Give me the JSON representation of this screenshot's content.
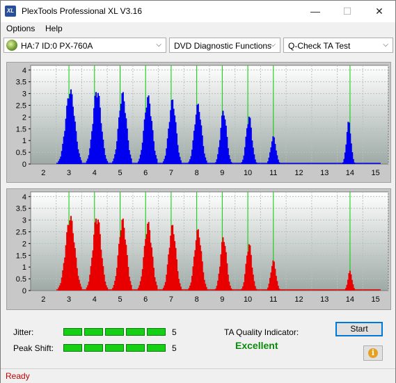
{
  "window": {
    "title": "PlexTools Professional XL V3.16",
    "icon_text": "XL",
    "minimize": "—",
    "maximize": "☐",
    "close": "✕"
  },
  "menu": {
    "items": [
      "Options",
      "Help"
    ]
  },
  "toolbar": {
    "drive": "HA:7 ID:0  PX-760A",
    "function": "DVD Diagnostic Functions",
    "test": "Q-Check TA Test"
  },
  "charts": {
    "x_ticks": [
      "2",
      "3",
      "4",
      "5",
      "6",
      "7",
      "8",
      "9",
      "10",
      "11",
      "12",
      "13",
      "14",
      "15"
    ],
    "y_ticks": [
      "4",
      "3.5",
      "3",
      "2.5",
      "2",
      "1.5",
      "1",
      "0.5",
      "0"
    ],
    "colors": {
      "top": "#0000ee",
      "bottom": "#e80000",
      "green_line": "#00cc00",
      "plot_bg_top": "#ffffff",
      "plot_bg_bottom": "#9eaaa6"
    }
  },
  "chart_data": [
    {
      "type": "bar",
      "series": [
        {
          "values": "see peaks"
        }
      ],
      "xlim": [
        1.5,
        15.5
      ],
      "ylim": [
        0,
        4.2
      ],
      "green_lines": [
        3,
        4,
        5,
        6,
        7,
        8,
        9,
        10,
        11,
        14
      ],
      "peaks": [
        {
          "center": 3.05,
          "height": 3.25,
          "width": 0.45
        },
        {
          "center": 4.1,
          "height": 3.3,
          "width": 0.4
        },
        {
          "center": 5.1,
          "height": 3.1,
          "width": 0.38
        },
        {
          "center": 6.1,
          "height": 2.95,
          "width": 0.38
        },
        {
          "center": 7.05,
          "height": 2.8,
          "width": 0.35
        },
        {
          "center": 8.05,
          "height": 2.6,
          "width": 0.35
        },
        {
          "center": 9.05,
          "height": 2.35,
          "width": 0.3
        },
        {
          "center": 10.05,
          "height": 2.1,
          "width": 0.28
        },
        {
          "center": 11.0,
          "height": 1.2,
          "width": 0.25
        },
        {
          "center": 13.95,
          "height": 1.85,
          "width": 0.22
        }
      ]
    },
    {
      "type": "bar",
      "xlim": [
        1.5,
        15.5
      ],
      "ylim": [
        0,
        4.2
      ],
      "green_lines": [
        3,
        4,
        5,
        6,
        7,
        8,
        9,
        10,
        11,
        14
      ],
      "peaks": [
        {
          "center": 3.05,
          "height": 3.25,
          "width": 0.45
        },
        {
          "center": 4.1,
          "height": 3.3,
          "width": 0.4
        },
        {
          "center": 5.1,
          "height": 3.1,
          "width": 0.38
        },
        {
          "center": 6.1,
          "height": 2.95,
          "width": 0.38
        },
        {
          "center": 7.05,
          "height": 2.85,
          "width": 0.35
        },
        {
          "center": 8.05,
          "height": 2.65,
          "width": 0.35
        },
        {
          "center": 9.05,
          "height": 2.35,
          "width": 0.3
        },
        {
          "center": 10.05,
          "height": 2.05,
          "width": 0.28
        },
        {
          "center": 11.0,
          "height": 1.3,
          "width": 0.25
        },
        {
          "center": 14.0,
          "height": 0.85,
          "width": 0.2
        }
      ]
    }
  ],
  "results": {
    "jitter_label": "Jitter:",
    "jitter_value": "5",
    "jitter_level": 5,
    "peak_shift_label": "Peak Shift:",
    "peak_shift_value": "5",
    "peak_shift_level": 5,
    "ta_label": "TA Quality Indicator:",
    "ta_value": "Excellent",
    "start_label": "Start",
    "info_icon": "i"
  },
  "status": {
    "text": "Ready"
  }
}
